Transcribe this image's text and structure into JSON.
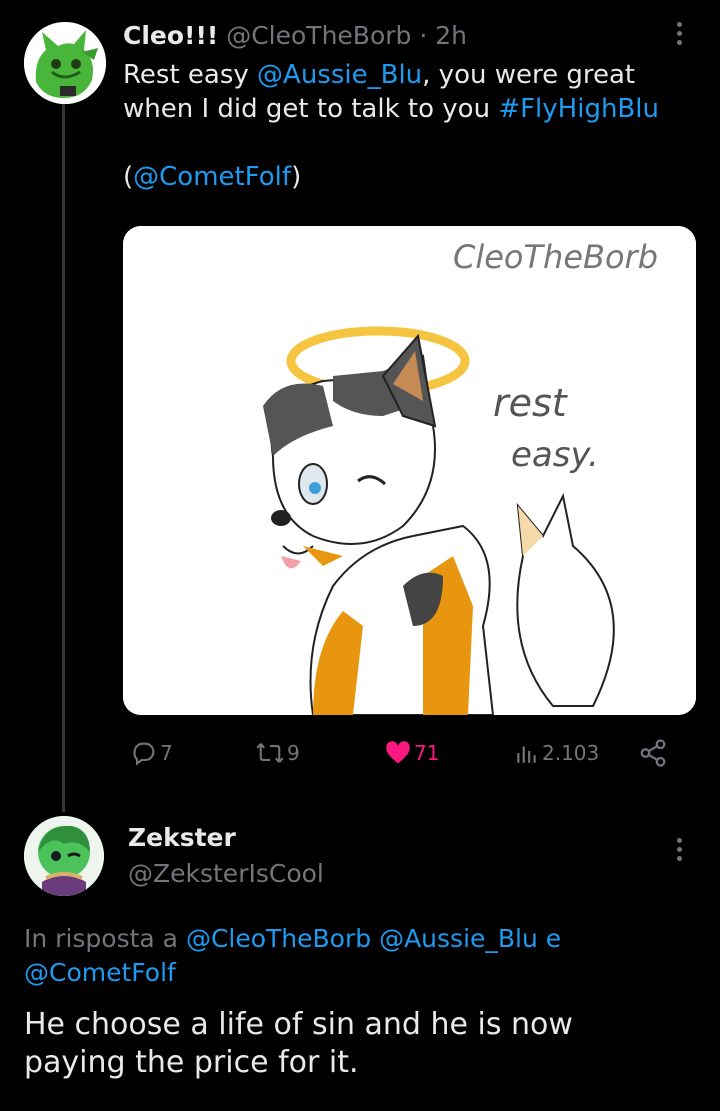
{
  "post": {
    "display_name": "Cleo!!!",
    "handle": "@CleoTheBorb",
    "separator": "·",
    "time": "2h",
    "text_prefix": "Rest easy ",
    "mention_1": "@Aussie_Blu",
    "text_mid_1": ", you were great",
    "text_line_2": "when I did get to talk to you ",
    "hashtag": "#FlyHighBlu",
    "credit_open": "(",
    "credit_mention": "@CometFolf",
    "credit_close": ")",
    "image": {
      "signature": "CleoTheBorb",
      "caption_line_1": "rest",
      "caption_line_2": "easy."
    },
    "stats": {
      "replies": "7",
      "reposts": "9",
      "likes": "71",
      "views": "2.103"
    },
    "colors": {
      "like_active": "#f91880",
      "link": "#1d9bf0",
      "muted": "#71767b"
    }
  },
  "reply": {
    "display_name": "Zekster",
    "handle": "@ZeksterIsCool",
    "in_reply_prefix": "In risposta a ",
    "in_reply_mention_1": "@CleoTheBorb",
    "in_reply_mention_2": "@Aussie_Blu",
    "in_reply_conj": " e",
    "in_reply_mention_3": "@CometFolf",
    "text_line_1": "He choose a life of sin and he is now",
    "text_line_2": "paying the price for it."
  },
  "icons": {
    "reply": "reply-icon",
    "repost": "repost-icon",
    "like": "heart-icon",
    "views": "views-icon",
    "share": "share-icon",
    "more": "more-vertical-icon"
  }
}
